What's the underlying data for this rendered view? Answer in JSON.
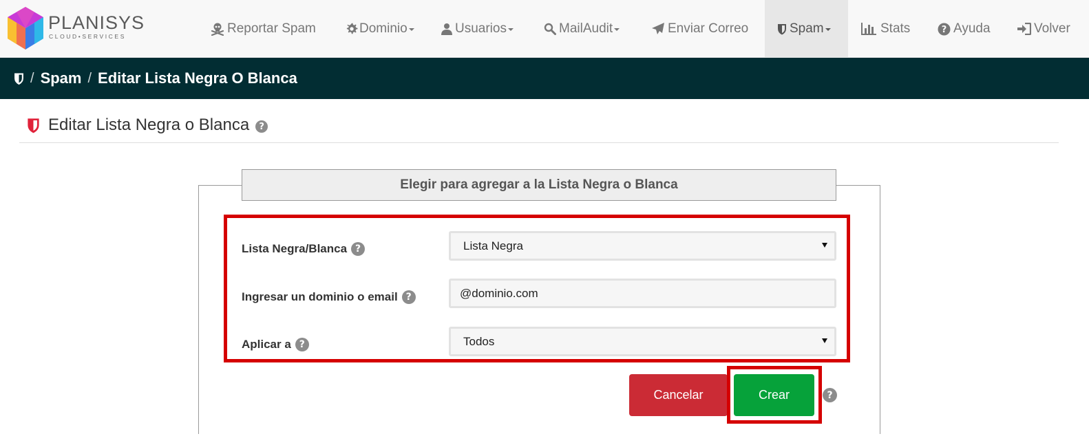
{
  "brand": {
    "name": "PLANISYS",
    "tagline": "CLOUD•SERVICES"
  },
  "nav": {
    "items": [
      {
        "label": "Reportar Spam",
        "icon": "skull-crossbones-icon",
        "dropdown": false
      },
      {
        "label": "Dominio",
        "icon": "gear-icon",
        "dropdown": true
      },
      {
        "label": "Usuarios",
        "icon": "user-icon",
        "dropdown": true
      },
      {
        "label": "MailAudit",
        "icon": "search-icon",
        "dropdown": true
      },
      {
        "label": "Enviar Correo",
        "icon": "paper-plane-icon",
        "dropdown": false
      },
      {
        "label": "Spam",
        "icon": "shield-icon",
        "dropdown": true,
        "active": true
      },
      {
        "label": "Stats",
        "icon": "bar-chart-icon",
        "dropdown": false
      },
      {
        "label": "Ayuda",
        "icon": "question-circle-icon",
        "dropdown": false
      },
      {
        "label": "Volver",
        "icon": "sign-in-icon",
        "dropdown": false
      }
    ]
  },
  "breadcrumb": {
    "home_icon": "shield-icon",
    "sep": "/",
    "items": [
      "Spam",
      "Editar Lista Negra O Blanca"
    ]
  },
  "page": {
    "title": "Editar Lista Negra o Blanca",
    "help": "?"
  },
  "form": {
    "legend": "Elegir para agregar a la Lista Negra o Blanca",
    "fields": [
      {
        "label": "Lista Negra/Blanca",
        "type": "select",
        "value": "Lista Negra"
      },
      {
        "label": "Ingresar un dominio o email",
        "type": "input",
        "value": "@dominio.com"
      },
      {
        "label": "Aplicar a",
        "type": "select",
        "value": "Todos"
      }
    ],
    "cancel_label": "Cancelar",
    "create_label": "Crear"
  },
  "colors": {
    "nav_bg": "#f8f8f8",
    "breadcrumb_bg": "#022d33",
    "highlight": "#d50000",
    "cancel": "#cb2b35",
    "create": "#06a23a",
    "title_icon": "#e0223a"
  }
}
